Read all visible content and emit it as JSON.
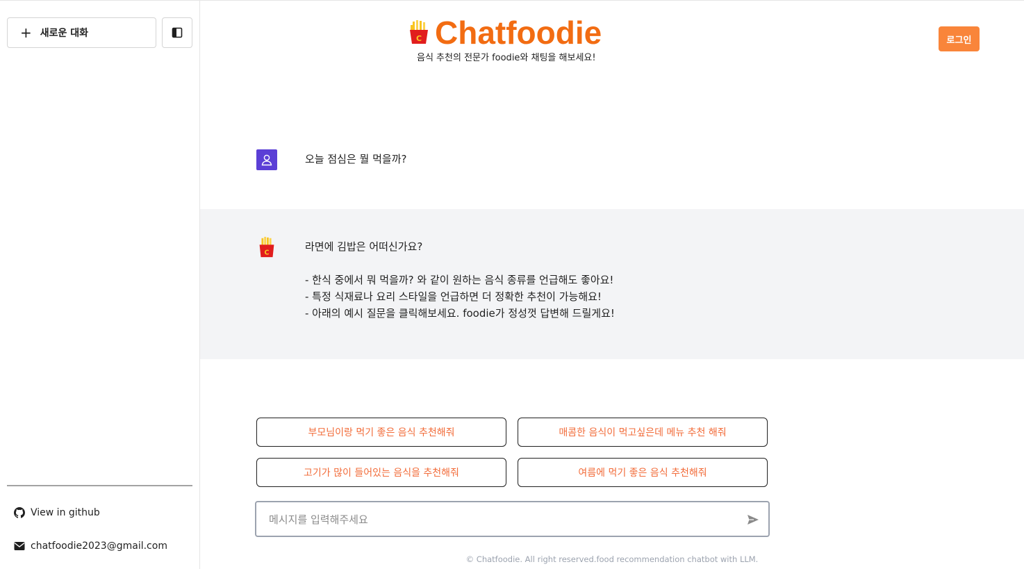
{
  "sidebar": {
    "new_chat_label": "새로운 대화",
    "links": {
      "github": "View in github",
      "email": "chatfoodie2023@gmail.com"
    }
  },
  "header": {
    "title": "Chatfoodie",
    "subtitle": "음식 추천의 전문가 foodie와 채팅을 해보세요!",
    "login_label": "로그인"
  },
  "conversation": {
    "user_message": "오늘 점심은 뭘 먹을까?",
    "bot_message": {
      "first": "라면에 김밥은 어떠신가요?",
      "tips": [
        "- 한식 중에서 뭐 먹을까? 와 같이 원하는 음식 종류를 언급해도 좋아요!",
        "- 특정 식재료나 요리 스타일을 언급하면 더 정확한 추천이 가능해요!",
        "- 아래의 예시 질문을 클릭해보세요. foodie가 정성껏 답변해 드릴게요!"
      ]
    }
  },
  "suggestions": [
    "부모님이랑 먹기 좋은 음식 추천해줘",
    "매콤한 음식이 먹고싶은데 메뉴 추천 해줘",
    "고기가 많이 들어있는 음식을 추천해줘",
    "여름에 먹기 좋은 음식 추천해줘"
  ],
  "input": {
    "placeholder": "메시지를 입력해주세요"
  },
  "footer": "© Chatfoodie. All right reserved.food recommendation chatbot with LLM.",
  "colors": {
    "brand": "#f26c12",
    "login": "#f9853a",
    "user_avatar": "#5b3fd6",
    "bot_bg": "#f3f4f6"
  },
  "icons": {
    "new_chat": "plus-icon",
    "toggle": "sidebar-toggle-icon",
    "github": "github-icon",
    "email": "envelope-icon",
    "user": "user-icon",
    "bot": "fries-icon",
    "send": "send-icon"
  }
}
